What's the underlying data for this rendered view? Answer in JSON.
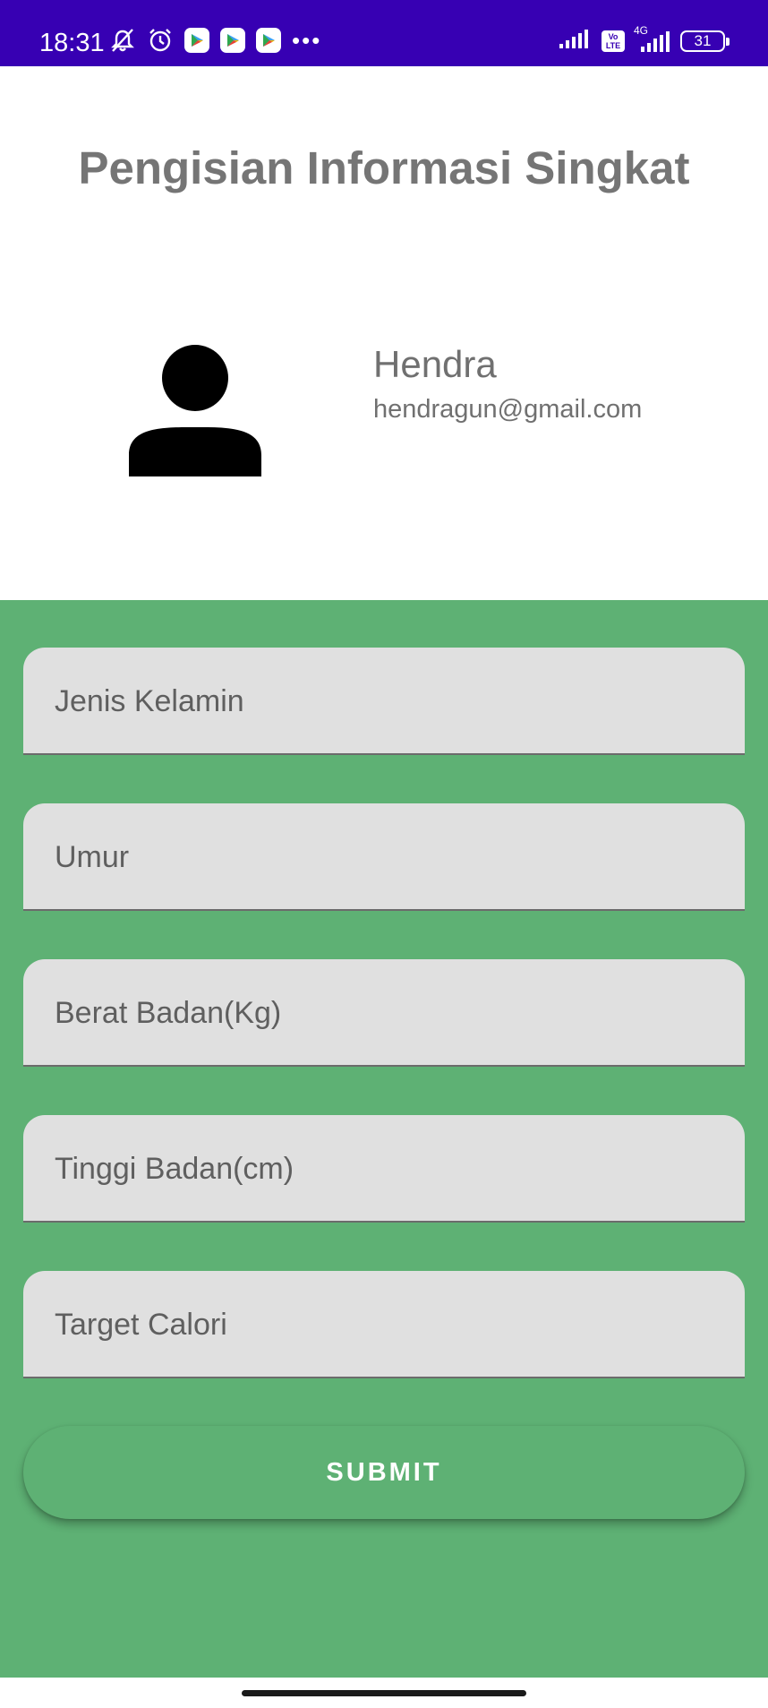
{
  "status_bar": {
    "time": "18:31",
    "icons_left": [
      "mute-notification-icon",
      "alarm-icon",
      "play-store-icon",
      "play-store-icon",
      "play-store-icon",
      "more-dots-icon"
    ],
    "more": "•••",
    "volte": {
      "line1": "Vo",
      "line2": "LTE"
    },
    "network": "4G",
    "battery": "31",
    "background_color": "#3700b3"
  },
  "header": {
    "title": "Pengisian Informasi Singkat"
  },
  "profile": {
    "avatar_icon": "person-icon",
    "name": "Hendra",
    "email": "hendragun@gmail.com"
  },
  "form": {
    "background_color": "#5eb174",
    "fields": [
      {
        "placeholder": "Jenis Kelamin"
      },
      {
        "placeholder": "Umur"
      },
      {
        "placeholder": "Berat Badan(Kg)"
      },
      {
        "placeholder": "Tinggi Badan(cm)"
      },
      {
        "placeholder": "Target Calori"
      }
    ],
    "submit_label": "SUBMIT"
  }
}
